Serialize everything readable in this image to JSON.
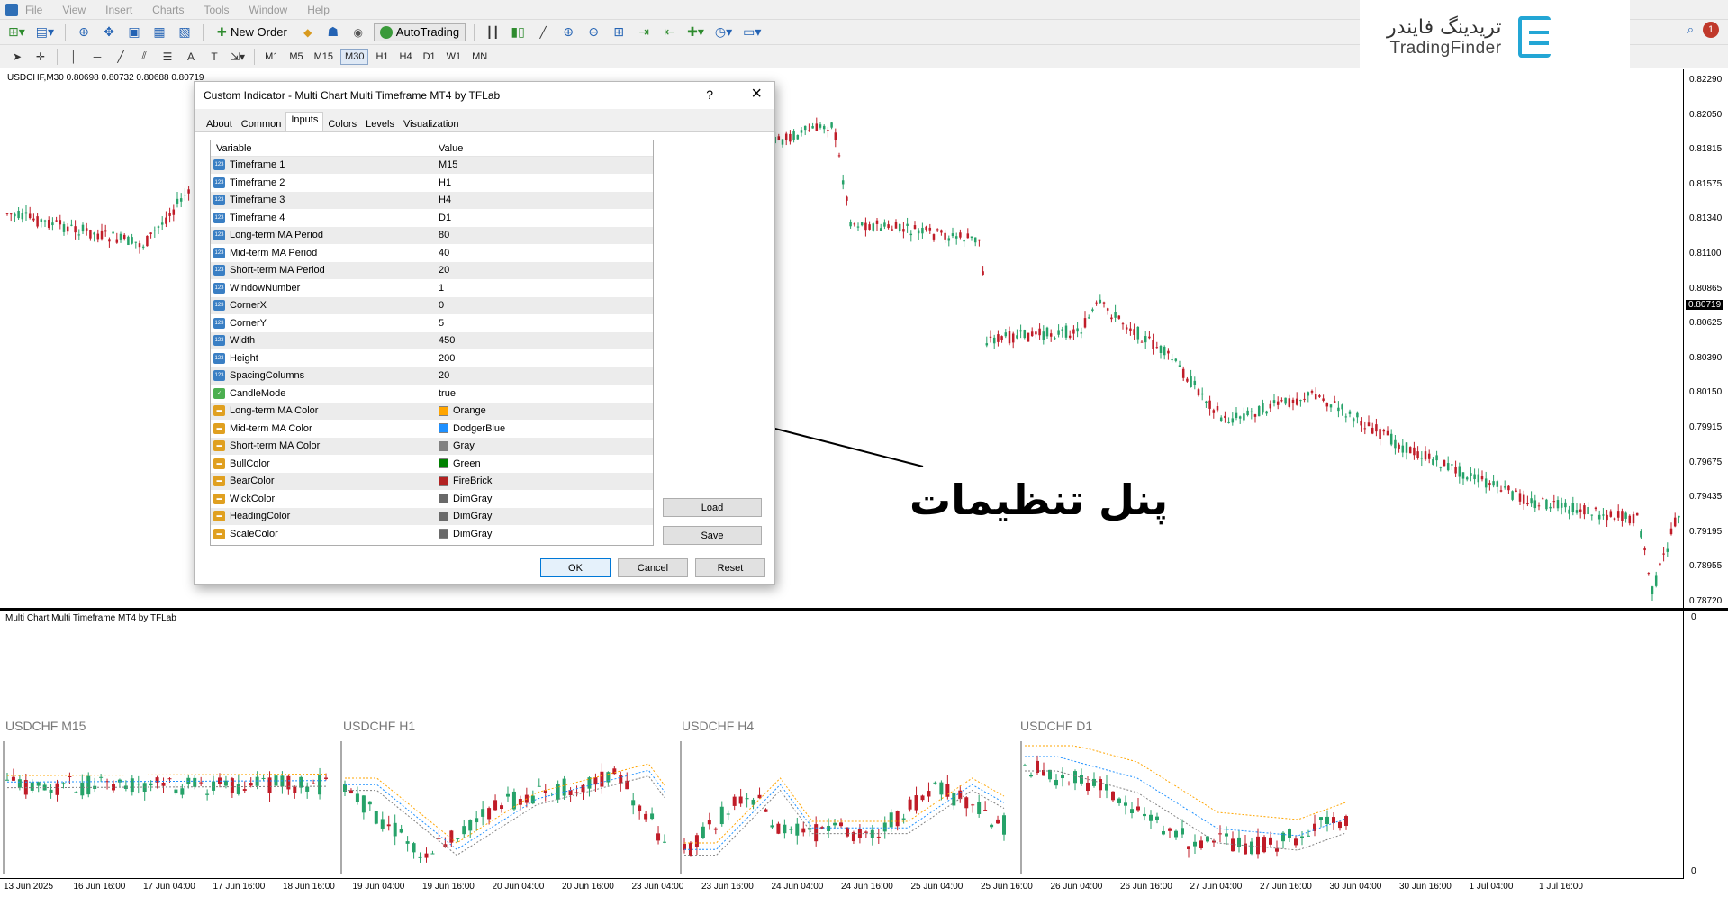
{
  "menu": [
    "File",
    "View",
    "Insert",
    "Charts",
    "Tools",
    "Window",
    "Help"
  ],
  "toolbar": {
    "new_order": "New Order",
    "autotrading": "AutoTrading"
  },
  "timeframes": [
    "M1",
    "M5",
    "M15",
    "M30",
    "H1",
    "H4",
    "D1",
    "W1",
    "MN"
  ],
  "active_timeframe": "M30",
  "logo": {
    "fa": "تریدینگ فایندر",
    "en": "TradingFinder",
    "color": "#23a6d5"
  },
  "notifications": "1",
  "chart": {
    "header": "USDCHF,M30  0.80698 0.80732 0.80688 0.80719",
    "current_price": "0.80719",
    "price_levels": [
      "0.82290",
      "0.82050",
      "0.81815",
      "0.81575",
      "0.81340",
      "0.81100",
      "0.80865",
      "0.80625",
      "0.80390",
      "0.80150",
      "0.79915",
      "0.79675",
      "0.79435",
      "0.79195",
      "0.78955",
      "0.78720"
    ]
  },
  "subwindow": {
    "title": "Multi Chart Multi Timeframe MT4 by TFLab",
    "axis_top": "0",
    "axis_bottom": "0",
    "mini_charts": [
      "USDCHF M15",
      "USDCHF H1",
      "USDCHF H4",
      "USDCHF D1"
    ]
  },
  "time_axis": [
    "13 Jun 2025",
    "16 Jun 16:00",
    "17 Jun 04:00",
    "17 Jun 16:00",
    "18 Jun 16:00",
    "19 Jun 04:00",
    "19 Jun 16:00",
    "20 Jun 04:00",
    "20 Jun 16:00",
    "23 Jun 04:00",
    "23 Jun 16:00",
    "24 Jun 04:00",
    "24 Jun 16:00",
    "25 Jun 04:00",
    "25 Jun 16:00",
    "26 Jun 04:00",
    "26 Jun 16:00",
    "27 Jun 04:00",
    "27 Jun 16:00",
    "30 Jun 04:00",
    "30 Jun 16:00",
    "1 Jul 04:00",
    "1 Jul 16:00"
  ],
  "dialog": {
    "title": "Custom Indicator - Multi Chart Multi Timeframe MT4 by TFLab",
    "help": "?",
    "tabs": [
      "About",
      "Common",
      "Inputs",
      "Colors",
      "Levels",
      "Visualization"
    ],
    "active_tab": "Inputs",
    "col_variable": "Variable",
    "col_value": "Value",
    "rows": [
      {
        "name": "Timeframe 1",
        "value": "M15",
        "type": "num"
      },
      {
        "name": "Timeframe 2",
        "value": "H1",
        "type": "num"
      },
      {
        "name": "Timeframe 3",
        "value": "H4",
        "type": "num"
      },
      {
        "name": "Timeframe 4",
        "value": "D1",
        "type": "num"
      },
      {
        "name": "Long-term MA Period",
        "value": "80",
        "type": "num"
      },
      {
        "name": "Mid-term MA Period",
        "value": "40",
        "type": "num"
      },
      {
        "name": "Short-term MA Period",
        "value": "20",
        "type": "num"
      },
      {
        "name": "WindowNumber",
        "value": "1",
        "type": "num"
      },
      {
        "name": "CornerX",
        "value": "0",
        "type": "num"
      },
      {
        "name": "CornerY",
        "value": "5",
        "type": "num"
      },
      {
        "name": "Width",
        "value": "450",
        "type": "num"
      },
      {
        "name": "Height",
        "value": "200",
        "type": "num"
      },
      {
        "name": "SpacingColumns",
        "value": "20",
        "type": "num"
      },
      {
        "name": "CandleMode",
        "value": "true",
        "type": "bool"
      },
      {
        "name": "Long-term MA Color",
        "value": "Orange",
        "type": "color",
        "swatch": "#ffa500"
      },
      {
        "name": "Mid-term MA Color",
        "value": "DodgerBlue",
        "type": "color",
        "swatch": "#1e90ff"
      },
      {
        "name": "Short-term MA Color",
        "value": "Gray",
        "type": "color",
        "swatch": "#808080"
      },
      {
        "name": "BullColor",
        "value": "Green",
        "type": "color",
        "swatch": "#008000"
      },
      {
        "name": "BearColor",
        "value": "FireBrick",
        "type": "color",
        "swatch": "#b22222"
      },
      {
        "name": "WickColor",
        "value": "DimGray",
        "type": "color",
        "swatch": "#696969"
      },
      {
        "name": "HeadingColor",
        "value": "DimGray",
        "type": "color",
        "swatch": "#696969"
      },
      {
        "name": "ScaleColor",
        "value": "DimGray",
        "type": "color",
        "swatch": "#696969"
      }
    ],
    "load": "Load",
    "save": "Save",
    "ok": "OK",
    "cancel": "Cancel",
    "reset": "Reset"
  },
  "annotation": "پنل تنظیمات",
  "colors": {
    "bull": "#26a269",
    "bear": "#c01c28"
  }
}
